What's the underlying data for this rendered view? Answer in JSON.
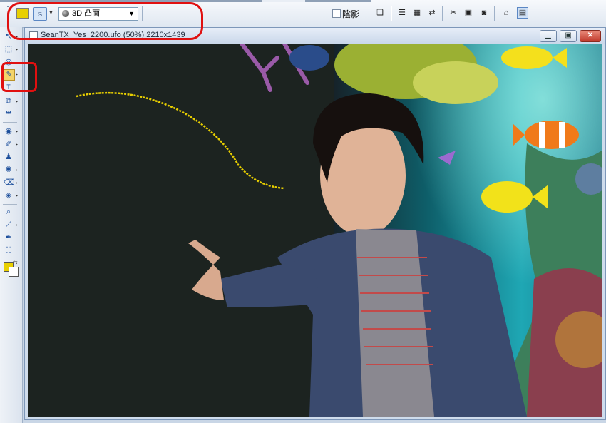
{
  "property_bar": {
    "fill_color": "#e8cf00",
    "curve_tool_icon": "freehand-path-icon",
    "effect_select": {
      "selected": "3D 凸面",
      "icon": "sphere-icon"
    },
    "shadow": {
      "label": "陰影",
      "checked": false
    }
  },
  "left_toolbar": {
    "active_tool": "path-edit-tool",
    "foreground_color": "#e8cf00",
    "background_color": "#ffffff"
  },
  "document": {
    "title": "SeanTX_Yes_2200.ufo (50%) 2210x1439",
    "window_buttons": [
      "minimize-icon",
      "restore-icon",
      "close-icon"
    ]
  },
  "annotations": {
    "color": "#e01010"
  }
}
